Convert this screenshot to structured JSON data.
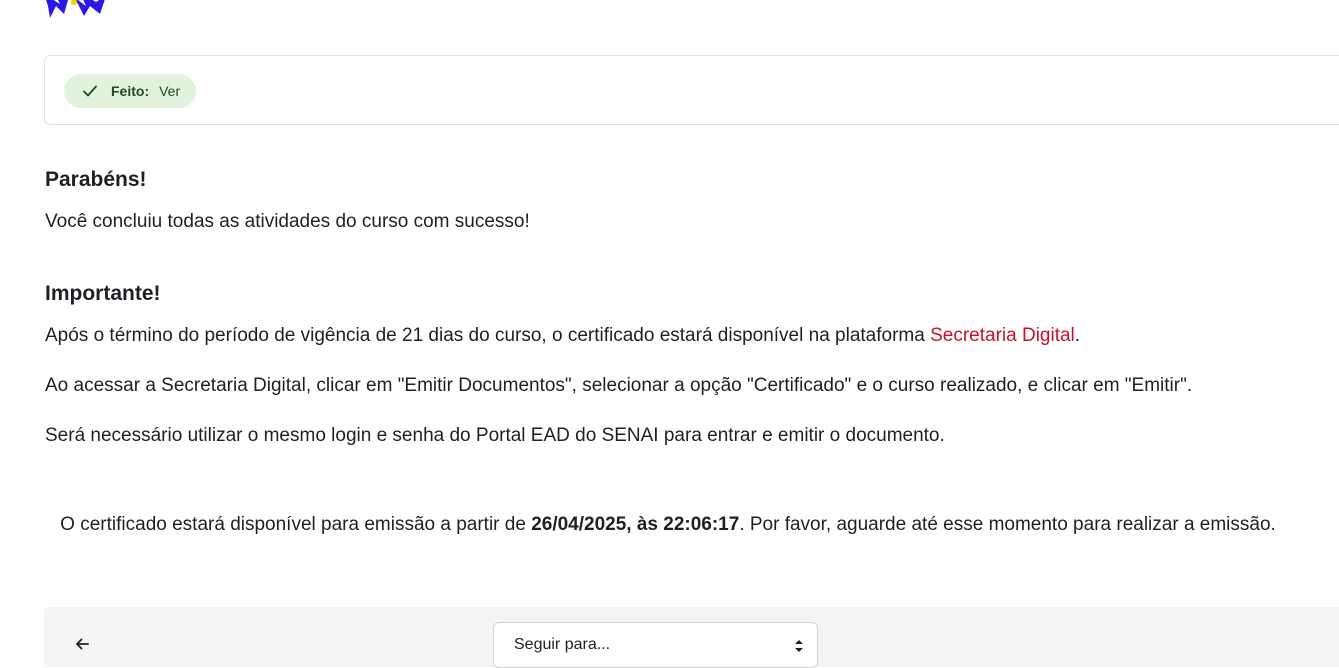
{
  "completion": {
    "status_label": "Feito:",
    "status_value": "Ver"
  },
  "congrats": {
    "title": "Parabéns!",
    "message": "Você concluiu todas as atividades do curso com sucesso!"
  },
  "important": {
    "title": "Importante!",
    "line1_prefix": "Após o término do período de vigência de 21 dias do curso, o certificado estará disponível na plataforma ",
    "line1_link": "Secretaria Digital",
    "line1_suffix": ".",
    "line2": "Ao acessar a Secretaria Digital, clicar em \"Emitir Documentos\", selecionar a opção \"Certificado\" e o curso realizado, e clicar em \"Emitir\".",
    "line3": "Será necessário utilizar o mesmo login e senha do Portal EAD do SENAI para entrar e emitir o documento."
  },
  "availability": {
    "prefix": "O certificado estará disponível para emissão a partir de ",
    "datetime": "26/04/2025, às 22:06:17",
    "suffix": ". Por favor, aguarde até esse momento para realizar a emissão."
  },
  "navigation": {
    "jump_placeholder": "Seguir para..."
  },
  "colors": {
    "link": "#c8102e",
    "badge_bg": "#e2f2dd",
    "footer_bg": "#f4f4f4"
  },
  "icons": {
    "logo": "star-logo-icon",
    "check": "check-icon",
    "back": "arrow-left-icon",
    "caret": "select-caret-icon"
  }
}
